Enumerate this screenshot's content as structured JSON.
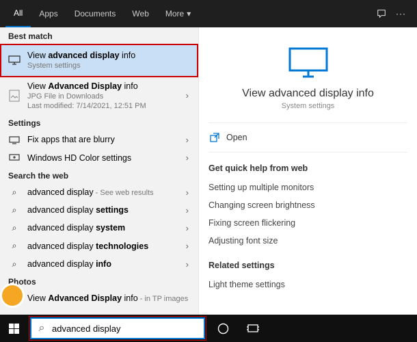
{
  "tabs": [
    "All",
    "Apps",
    "Documents",
    "Web",
    "More"
  ],
  "left": {
    "best_match_h": "Best match",
    "best": {
      "title_pre": "View ",
      "title_bold": "advanced display",
      "title_post": " info",
      "sub": "System settings"
    },
    "file": {
      "title_pre": "View ",
      "title_bold": "Advanced Display",
      "title_post": " info",
      "sub1": "JPG File in Downloads",
      "sub2": "Last modified: 7/14/2021, 12:51 PM"
    },
    "settings_h": "Settings",
    "settings": [
      "Fix apps that are blurry",
      "Windows HD Color settings"
    ],
    "web_h": "Search the web",
    "web": [
      {
        "pre": "advanced display",
        "bold": "",
        "post": "",
        "hint": " - See web results"
      },
      {
        "pre": "advanced display ",
        "bold": "settings",
        "post": "",
        "hint": ""
      },
      {
        "pre": "advanced display ",
        "bold": "system",
        "post": "",
        "hint": ""
      },
      {
        "pre": "advanced display ",
        "bold": "technologies",
        "post": "",
        "hint": ""
      },
      {
        "pre": "advanced display ",
        "bold": "info",
        "post": "",
        "hint": ""
      }
    ],
    "photos_h": "Photos",
    "photo": {
      "pre": "View ",
      "bold": "Advanced Display",
      "post": " info",
      "hint": " - in TP images"
    }
  },
  "right": {
    "title": "View advanced display info",
    "sub": "System settings",
    "open": "Open",
    "help_h": "Get quick help from web",
    "help": [
      "Setting up multiple monitors",
      "Changing screen brightness",
      "Fixing screen flickering",
      "Adjusting font size"
    ],
    "related_h": "Related settings",
    "related": [
      "Light theme settings"
    ]
  },
  "search_value": "advanced display"
}
